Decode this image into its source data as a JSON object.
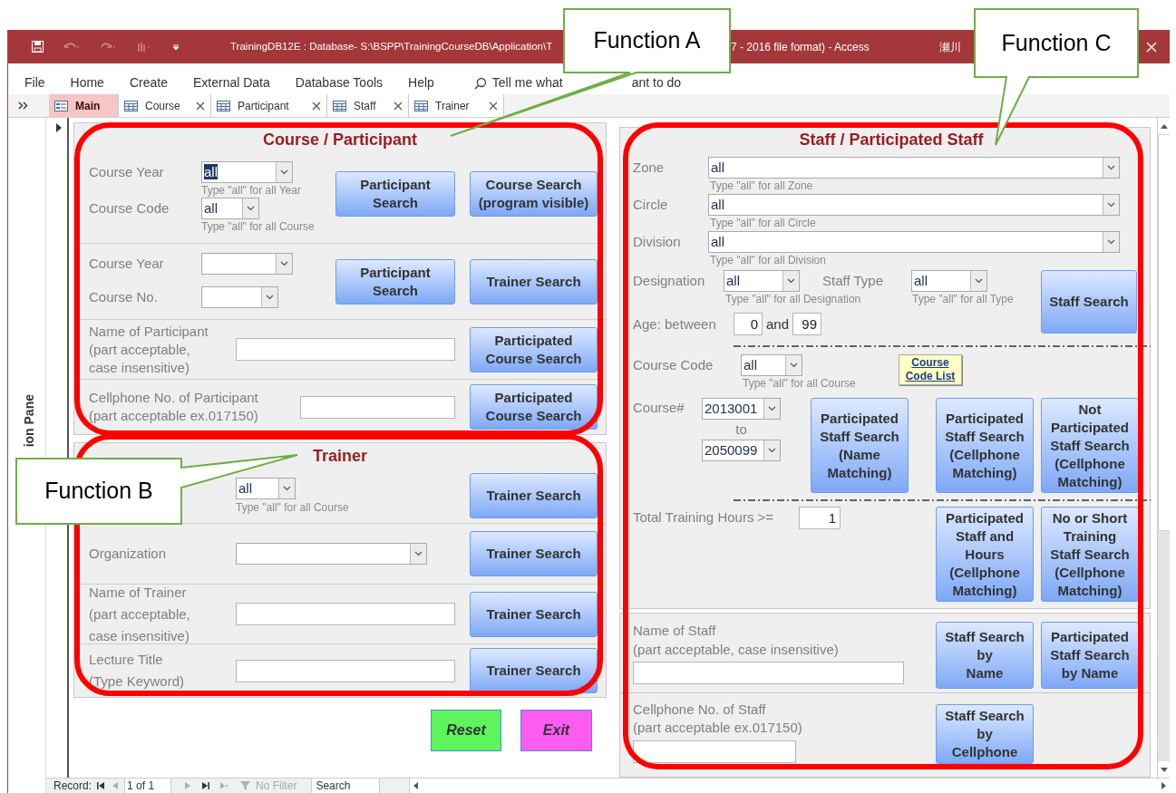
{
  "window": {
    "title_start": "TrainingDB12E : Database- S:\\BSPP\\TrainingCourseDB\\Application\\T",
    "title_end": "7 - 2016 file format)  -  Access",
    "user": "瀬川"
  },
  "menu": [
    {
      "label": "File"
    },
    {
      "label": "Home"
    },
    {
      "label": "Create"
    },
    {
      "label": "External Data"
    },
    {
      "label": "Database Tools"
    },
    {
      "label": "Help"
    }
  ],
  "tell_me": {
    "before": "Tell me what",
    "after": "ant to do"
  },
  "tabs": [
    {
      "label": "Main",
      "selected": true
    },
    {
      "label": "Course",
      "selected": false
    },
    {
      "label": "Participant",
      "selected": false
    },
    {
      "label": "Staff",
      "selected": false
    },
    {
      "label": "Trainer",
      "selected": false
    }
  ],
  "nav_pane": {
    "label": "ion Pane"
  },
  "course_participant": {
    "title": "Course / Participant",
    "year_code": {
      "fields": [
        {
          "label": "Course Year",
          "value": "all",
          "hint": "Type \"all\" for all Year",
          "highlighted": true
        },
        {
          "label": "Course Code",
          "value": "all",
          "hint": "Type \"all\" for all Course",
          "highlighted": false
        }
      ],
      "buttons": [
        [
          "Participant",
          "Search"
        ],
        [
          "Course Search",
          "(program visible)"
        ]
      ]
    },
    "year_no": {
      "fields": [
        {
          "label": "Course Year"
        },
        {
          "label": "Course No."
        }
      ],
      "buttons": [
        [
          "Participant",
          "Search"
        ],
        [
          "Trainer Search"
        ]
      ]
    },
    "name": {
      "label": [
        "Name of Participant",
        "(part acceptable,",
        "case insensitive)"
      ],
      "button": [
        "Participated",
        "Course Search"
      ]
    },
    "cellphone": {
      "label": [
        "Cellphone No. of Participant",
        "(part acceptable  ex.017150)"
      ],
      "button": [
        "Participated",
        "Course Search"
      ]
    }
  },
  "trainer": {
    "title": "Trainer",
    "rows": [
      {
        "kind": "combo",
        "value": "all",
        "hint": "Type \"all\" for all Course",
        "button": [
          "Trainer Search"
        ]
      },
      {
        "kind": "combo",
        "label": [
          "Organization"
        ],
        "button": [
          "Trainer Search"
        ]
      },
      {
        "kind": "text",
        "label": [
          "Name of Trainer",
          "(part acceptable,",
          "case insensitive)"
        ],
        "button": [
          "Trainer Search"
        ]
      },
      {
        "kind": "text",
        "label": [
          "Lecture Title",
          "(Type Keyword)"
        ],
        "button": [
          "Trainer Search"
        ]
      }
    ]
  },
  "actions": [
    {
      "label": "Reset",
      "color": "#5cf55c"
    },
    {
      "label": "Exit",
      "color": "#ff5cf2"
    }
  ],
  "staff": {
    "title": "Staff / Participated Staff",
    "wide_fields": [
      {
        "label": "Zone",
        "value": "all",
        "hint": "Type \"all\" for all Zone"
      },
      {
        "label": "Circle",
        "value": "all",
        "hint": "Type \"all\" for all Circle"
      },
      {
        "label": "Division",
        "value": "all",
        "hint": "Type \"all\" for all Division"
      }
    ],
    "designation": {
      "label": "Designation",
      "value": "all",
      "hint": "Type \"all\" for all Designation"
    },
    "staff_type": {
      "label": "Staff Type",
      "value": "all",
      "hint": "Type \"all\" for all Type"
    },
    "staff_search": [
      "Staff Search"
    ],
    "age": {
      "label": "Age: between",
      "from": "0",
      "joiner": "and",
      "to": "99"
    },
    "course_code": {
      "label": "Course Code",
      "value": "all",
      "hint": "Type \"all\" for all Course"
    },
    "code_list_link": [
      "Course",
      "Code List"
    ],
    "course_range": {
      "label": "Course#",
      "from": "2013001",
      "joiner": "to",
      "to": "2050099"
    },
    "course_buttons": [
      [
        "Participated",
        "Staff Search",
        "(Name",
        "Matching)"
      ],
      [
        "Participated",
        "Staff Search",
        "(Cellphone",
        "Matching)"
      ],
      [
        "Not",
        "Participated",
        "Staff Search",
        "(Cellphone",
        "Matching)"
      ]
    ],
    "hours": {
      "label": "Total Training Hours >=",
      "value": "1"
    },
    "hours_buttons": [
      [
        "Participated",
        "Staff and",
        "Hours",
        "(Cellphone",
        "Matching)"
      ],
      [
        "No or Short",
        "Training",
        "Staff Search",
        "(Cellphone",
        "Matching)"
      ]
    ]
  },
  "staff_name": {
    "label": [
      "Name of Staff",
      "(part acceptable, case insensitive)"
    ],
    "buttons": [
      [
        "Staff Search",
        "by",
        "Name"
      ],
      [
        "Participated",
        "Staff Search",
        "by Name"
      ]
    ]
  },
  "staff_cellphone": {
    "label": [
      "Cellphone No. of Staff",
      "(part acceptable  ex.017150)"
    ],
    "buttons": [
      [
        "Staff Search",
        "by",
        "Cellphone"
      ]
    ]
  },
  "record_nav": {
    "label": "Record:",
    "position": "1 of 1",
    "filter": "No Filter",
    "search": "Search"
  },
  "annotations": [
    {
      "label": "Function A"
    },
    {
      "label": "Function B"
    },
    {
      "label": "Function C"
    }
  ]
}
